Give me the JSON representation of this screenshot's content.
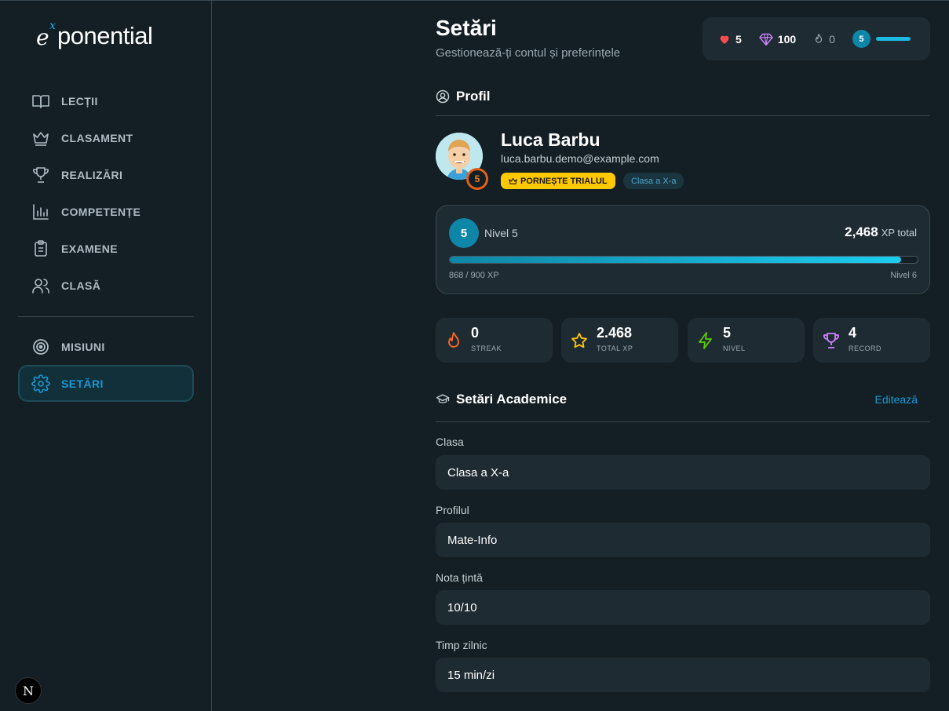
{
  "brand": {
    "e": "e",
    "x": "x",
    "word": "ponential"
  },
  "nav": {
    "items": [
      {
        "label": "LECȚII",
        "icon": "book-icon"
      },
      {
        "label": "CLASAMENT",
        "icon": "crown-icon"
      },
      {
        "label": "REALIZĂRI",
        "icon": "trophy-icon"
      },
      {
        "label": "COMPETENȚE",
        "icon": "bar-chart-icon"
      },
      {
        "label": "EXAMENE",
        "icon": "clipboard-icon"
      },
      {
        "label": "CLASĂ",
        "icon": "users-icon"
      }
    ],
    "secondary": [
      {
        "label": "MISIUNI",
        "icon": "target-icon"
      },
      {
        "label": "SETĂRI",
        "icon": "gear-icon",
        "active": true
      }
    ]
  },
  "dev_badge": "N",
  "header": {
    "title": "Setări",
    "subtitle": "Gestionează-ți contul și preferințele"
  },
  "statbar": {
    "hearts": "5",
    "gems": "100",
    "streak": "0",
    "level": "5"
  },
  "profile": {
    "section_title": "Profil",
    "name": "Luca Barbu",
    "email": "luca.barbu.demo@example.com",
    "avatar_level": "5",
    "trial_label": "PORNEȘTE TRIALUL",
    "class_chip": "Clasa a X-a"
  },
  "level_card": {
    "level_num": "5",
    "level_label": "Nivel 5",
    "total_xp": "2,468",
    "total_xp_suffix": "XP total",
    "progress_text": "868 / 900 XP",
    "progress_fraction": 0.964,
    "next_level": "Nivel 6"
  },
  "stats": [
    {
      "value": "0",
      "label": "STREAK",
      "icon": "flame-icon",
      "color": "#ff6a1a"
    },
    {
      "value": "2.468",
      "label": "TOTAL XP",
      "icon": "star-icon",
      "color": "#ffc800"
    },
    {
      "value": "5",
      "label": "NIVEL",
      "icon": "bolt-icon",
      "color": "#58cc02"
    },
    {
      "value": "4",
      "label": "RECORD",
      "icon": "trophy-icon",
      "color": "#ce82ff"
    }
  ],
  "academic": {
    "section_title": "Setări Academice",
    "edit_label": "Editează",
    "fields": [
      {
        "label": "Clasa",
        "value": "Clasa a X-a"
      },
      {
        "label": "Profilul",
        "value": "Mate-Info"
      },
      {
        "label": "Nota țintă",
        "value": "10/10"
      },
      {
        "label": "Timp zilnic",
        "value": "15 min/zi"
      }
    ]
  },
  "colors": {
    "background": "#131f24",
    "card": "#1f2b33",
    "accent": "#1899d6",
    "level": "#0e86a8",
    "trial": "#ffc800"
  }
}
